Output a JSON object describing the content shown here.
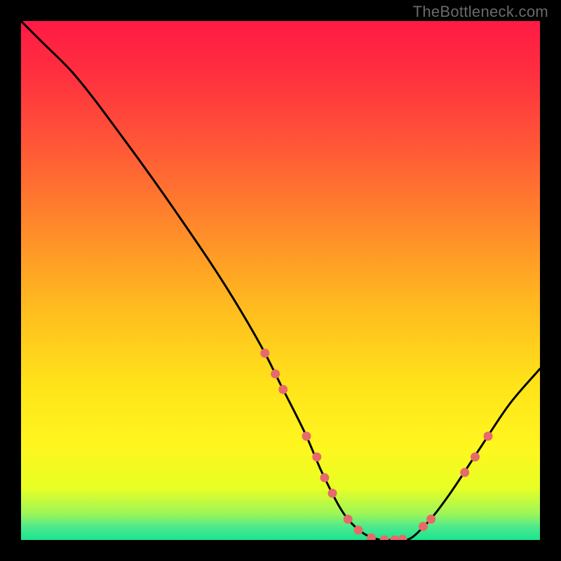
{
  "watermark": "TheBottleneck.com",
  "chart_data": {
    "type": "line",
    "title": "",
    "xlabel": "",
    "ylabel": "",
    "xlim": [
      0,
      100
    ],
    "ylim": [
      0,
      100
    ],
    "curve": {
      "name": "bottleneck-curve",
      "x": [
        0,
        4,
        10,
        20,
        30,
        40,
        47,
        50,
        55,
        58,
        63,
        70,
        74,
        78,
        82,
        88,
        94,
        100
      ],
      "y": [
        100,
        96,
        90,
        77,
        63,
        48,
        36,
        30,
        20,
        13,
        4,
        0,
        0,
        3,
        8,
        17,
        26,
        33
      ]
    },
    "markers": [
      {
        "x": 47.0,
        "y": 36.0
      },
      {
        "x": 49.0,
        "y": 32.0
      },
      {
        "x": 50.5,
        "y": 29.0
      },
      {
        "x": 55.0,
        "y": 20.0
      },
      {
        "x": 57.0,
        "y": 16.0
      },
      {
        "x": 58.5,
        "y": 12.0
      },
      {
        "x": 60.0,
        "y": 9.0
      },
      {
        "x": 63.0,
        "y": 4.0
      },
      {
        "x": 65.0,
        "y": 1.9
      },
      {
        "x": 67.5,
        "y": 0.4
      },
      {
        "x": 70.0,
        "y": 0.0
      },
      {
        "x": 72.0,
        "y": 0.0
      },
      {
        "x": 73.5,
        "y": 0.1
      },
      {
        "x": 77.5,
        "y": 2.6
      },
      {
        "x": 79.0,
        "y": 4.0
      },
      {
        "x": 85.5,
        "y": 13.0
      },
      {
        "x": 87.5,
        "y": 16.0
      },
      {
        "x": 90.0,
        "y": 20.0
      }
    ],
    "background_gradient": {
      "type": "vertical",
      "stops": [
        {
          "pos": 0.0,
          "color": "#ff1a44"
        },
        {
          "pos": 0.1,
          "color": "#ff2f3f"
        },
        {
          "pos": 0.25,
          "color": "#ff5a36"
        },
        {
          "pos": 0.4,
          "color": "#ff8a2a"
        },
        {
          "pos": 0.55,
          "color": "#ffbb1f"
        },
        {
          "pos": 0.7,
          "color": "#ffe31a"
        },
        {
          "pos": 0.82,
          "color": "#fff61f"
        },
        {
          "pos": 0.9,
          "color": "#e7ff24"
        },
        {
          "pos": 0.95,
          "color": "#9cf559"
        },
        {
          "pos": 0.975,
          "color": "#4de98d"
        },
        {
          "pos": 1.0,
          "color": "#19e58f"
        }
      ]
    },
    "marker_color": "#e76a6a",
    "curve_color": "#000000"
  }
}
